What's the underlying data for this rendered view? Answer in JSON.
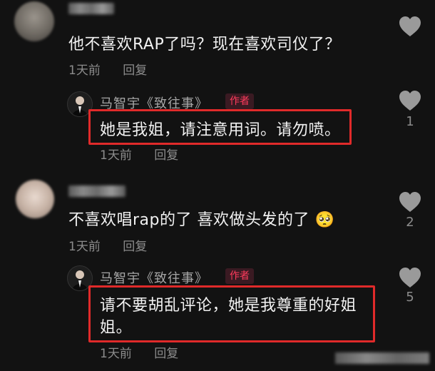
{
  "comments": [
    {
      "text": "他不喜欢RAP了吗？现在喜欢司仪了？",
      "time": "1天前",
      "reply_label": "回复",
      "likes": "",
      "reply": {
        "author": "马智宇《致往事》",
        "badge": "作者",
        "text": "她是我姐，请注意用词。请勿喷。",
        "time": "1天前",
        "reply_label": "回复",
        "likes": "1"
      }
    },
    {
      "text": "不喜欢唱rap的了 喜欢做头发的了",
      "emoji": "🥺",
      "time": "1天前",
      "reply_label": "回复",
      "likes": "2",
      "reply": {
        "author": "马智宇《致往事》",
        "badge": "作者",
        "text_line1": "请不要胡乱评论，她是我尊重的好姐",
        "text_line2": "姐。",
        "time": "1天前",
        "reply_label": "回复",
        "likes": "5"
      }
    }
  ],
  "colors": {
    "background": "#121212",
    "highlight_box": "#e02a2a",
    "author_badge": "#ff3b5c",
    "heart": "#9a9a9a"
  },
  "icons": {
    "like": "heart-icon",
    "emoji": "pleading-face-emoji"
  }
}
